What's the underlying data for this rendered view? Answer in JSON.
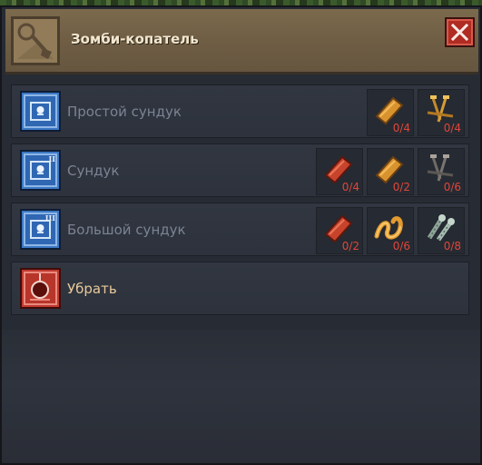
{
  "window": {
    "title": "Зомби-копатель",
    "close_label": "close",
    "icon": "shovel-icon"
  },
  "options": [
    {
      "label": "Простой сундук",
      "icon": "chest-icon",
      "active": false,
      "ingredients": [
        {
          "item": "plank-icon",
          "count": "0/4"
        },
        {
          "item": "nails-icon",
          "count": "0/4"
        }
      ]
    },
    {
      "label": "Сундук",
      "icon": "chest-icon",
      "tier": "II",
      "active": false,
      "ingredients": [
        {
          "item": "red-plank-icon",
          "count": "0/4"
        },
        {
          "item": "plank-icon",
          "count": "0/2"
        },
        {
          "item": "dark-nails-icon",
          "count": "0/6"
        }
      ]
    },
    {
      "label": "Большой сундук",
      "icon": "chest-icon",
      "tier": "III",
      "active": false,
      "ingredients": [
        {
          "item": "red-plank-icon",
          "count": "0/2"
        },
        {
          "item": "rope-icon",
          "count": "0/6"
        },
        {
          "item": "screws-icon",
          "count": "0/8"
        }
      ]
    },
    {
      "label": "Убрать",
      "icon": "demolish-icon",
      "active": true,
      "ingredients": []
    }
  ]
}
